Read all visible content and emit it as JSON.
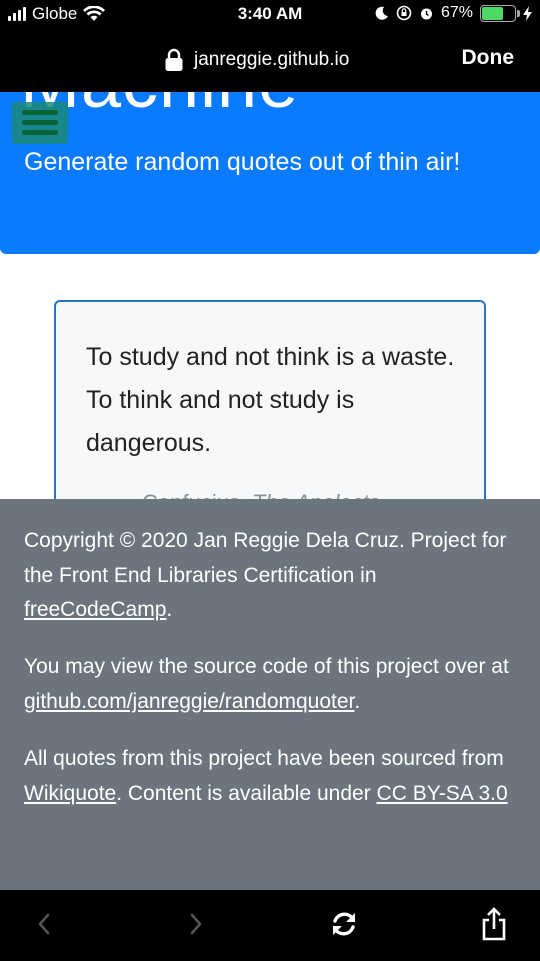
{
  "status_bar": {
    "carrier": "Globe",
    "time": "3:40 AM",
    "battery": "67%",
    "battery_level": 0.67
  },
  "url_bar": {
    "domain": "janreggie.github.io",
    "done_label": "Done"
  },
  "hero": {
    "title_partial": "Machine",
    "subtitle": "Generate random quotes out of thin air!"
  },
  "quote": {
    "text": "To study and not think is a waste. To think and not study is dangerous.",
    "author": "— Confucius, ",
    "source": "The Analects"
  },
  "footer": {
    "p1": {
      "text_a": "Copyright © 2020 Jan Reggie Dela Cruz. Project for the Front End Libraries Certification in ",
      "link": "freeCodeCamp",
      "text_b": "."
    },
    "p2": {
      "text_a": "You may view the source code of this project over at ",
      "link": "github.com/janreggie/randomquoter",
      "text_b": "."
    },
    "p3": {
      "text_a": "All quotes from this project have been sourced from ",
      "link1": "Wikiquote",
      "text_b": ". Content is available under ",
      "link2": "CC BY-SA 3.0"
    }
  },
  "toolbar": {
    "icons": [
      "back-icon",
      "forward-icon",
      "reload-icon",
      "share-icon"
    ]
  }
}
